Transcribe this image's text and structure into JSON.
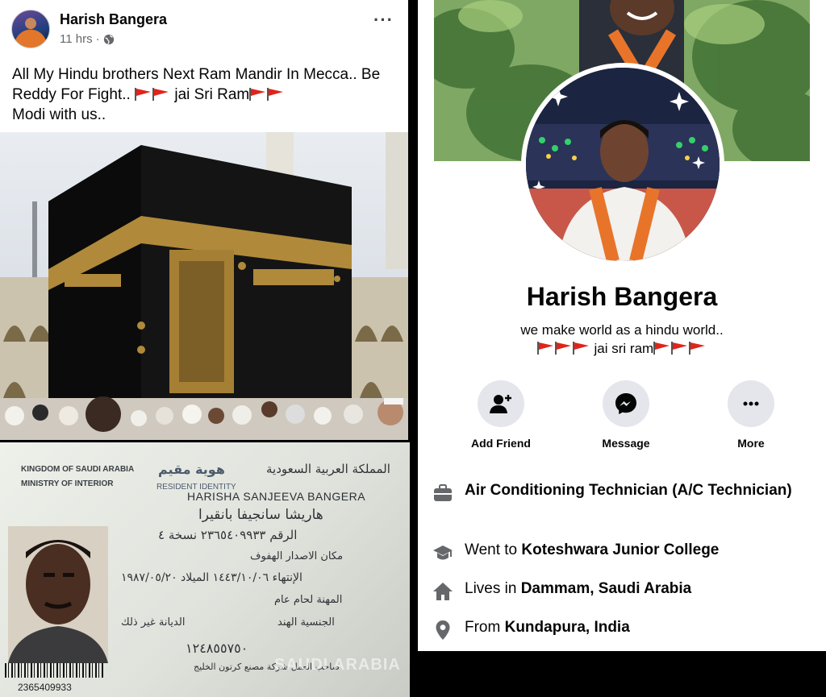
{
  "post": {
    "author": "Harish Bangera",
    "time": "11 hrs",
    "more": "···",
    "text_line1_a": "All My Hindu brothers Next Ram Mandir In Mecca.. Be",
    "text_line2_a": "Reddy For Fight..",
    "text_line2_b": "jai Sri Ram",
    "text_line3": "Modi with us.."
  },
  "id_card": {
    "country": "KINGDOM OF SAUDI ARABIA",
    "ministry": "MINISTRY OF INTERIOR",
    "doc_type": "RESIDENT IDENTITY",
    "holder_name": "HARISHA SANJEEVA BANGERA",
    "arabic_title_right": "المملكة العربية السعودية",
    "arabic_title_left": "هوية مقيم",
    "arabic_name": "هاريشا سانجيفا بانقيرا",
    "arabic_number_row": "الرقم ٢٣٦٥٤٠٩٩٣٣ نسخة ٤",
    "arabic_issue_place": "مكان الاصدار الهفوف",
    "arabic_expiry_row": "الإنتهاء ١٤٤٣/١٠/٠٦ الميلاد ١٩٨٧/٠٥/٢٠",
    "arabic_profession": "المهنة لحام عام",
    "arabic_nationality": "الجنسية الهند",
    "arabic_religion": "الديانة غير ذلك",
    "arabic_employer_number": "١٢٤٨٥٥٧٥٠",
    "arabic_employer": "صاحب العمل شركة مصنع كرتون الخليج",
    "barcode_number": "2365409933",
    "watermark": "SAUDI ARABIA"
  },
  "profile": {
    "name": "Harish Bangera",
    "bio_line1": "we make world as a hindu world..",
    "bio_line2": "jai sri ram",
    "actions": {
      "add_friend": "Add Friend",
      "message": "Message",
      "more": "More"
    },
    "info": {
      "work": "Air Conditioning Technician (A/C Technician)",
      "education_prefix": "Went to",
      "education": "Koteshwara Junior College",
      "lives_prefix": "Lives in",
      "lives": "Dammam, Saudi Arabia",
      "from_prefix": "From",
      "from": "Kundapura, India"
    }
  },
  "colors": {
    "facebook_text": "#050505",
    "meta_gray": "#65676b",
    "button_gray": "#e4e6eb",
    "flag_red": "#e0241b",
    "saffron": "#e8742a"
  },
  "icons": [
    "globe-icon",
    "flag-icon",
    "add-friend-icon",
    "messenger-icon",
    "more-dots-icon",
    "briefcase-icon",
    "graduation-cap-icon",
    "home-icon",
    "location-pin-icon"
  ]
}
